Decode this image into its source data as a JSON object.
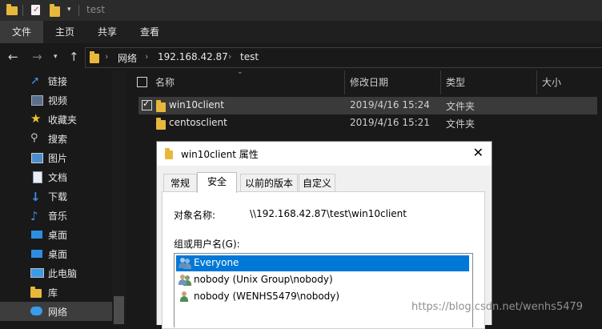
{
  "window": {
    "title": "test"
  },
  "ribbon": {
    "tabs": [
      "文件",
      "主页",
      "共享",
      "查看"
    ]
  },
  "address": {
    "crumbs": [
      "网络",
      "192.168.42.87",
      "test"
    ]
  },
  "sidebar": {
    "items": [
      {
        "label": "链接",
        "icon": "link-icon"
      },
      {
        "label": "视频",
        "icon": "video-icon"
      },
      {
        "label": "收藏夹",
        "icon": "star-icon"
      },
      {
        "label": "搜索",
        "icon": "search-icon"
      },
      {
        "label": "图片",
        "icon": "pictures-icon"
      },
      {
        "label": "文档",
        "icon": "document-icon"
      },
      {
        "label": "下载",
        "icon": "download-icon"
      },
      {
        "label": "音乐",
        "icon": "music-icon"
      },
      {
        "label": "桌面",
        "icon": "desktop-icon"
      },
      {
        "label": "桌面",
        "icon": "desktop-icon"
      },
      {
        "label": "此电脑",
        "icon": "computer-icon"
      },
      {
        "label": "库",
        "icon": "library-icon"
      },
      {
        "label": "网络",
        "icon": "network-icon"
      }
    ]
  },
  "list": {
    "columns": [
      "名称",
      "修改日期",
      "类型",
      "大小"
    ],
    "rows": [
      {
        "name": "win10client",
        "date": "2019/4/16 15:24",
        "type": "文件夹",
        "checked": true
      },
      {
        "name": "centosclient",
        "date": "2019/4/16 15:21",
        "type": "文件夹",
        "checked": false
      }
    ]
  },
  "dialog": {
    "title": "win10client 属性",
    "close": "✕",
    "tabs": [
      "常规",
      "安全",
      "以前的版本",
      "自定义"
    ],
    "object_label": "对象名称:",
    "object_value": "\\\\192.168.42.87\\test\\win10client",
    "group_label": "组或用户名(G):",
    "users": [
      "Everyone",
      "nobody (Unix Group\\nobody)",
      "nobody (WENHS5479\\nobody)"
    ]
  },
  "watermark": "https://blog.csdn.net/wenhs5479",
  "colors": {
    "accent": "#0078d7",
    "folder": "#e8b83c",
    "background": "#191919"
  }
}
